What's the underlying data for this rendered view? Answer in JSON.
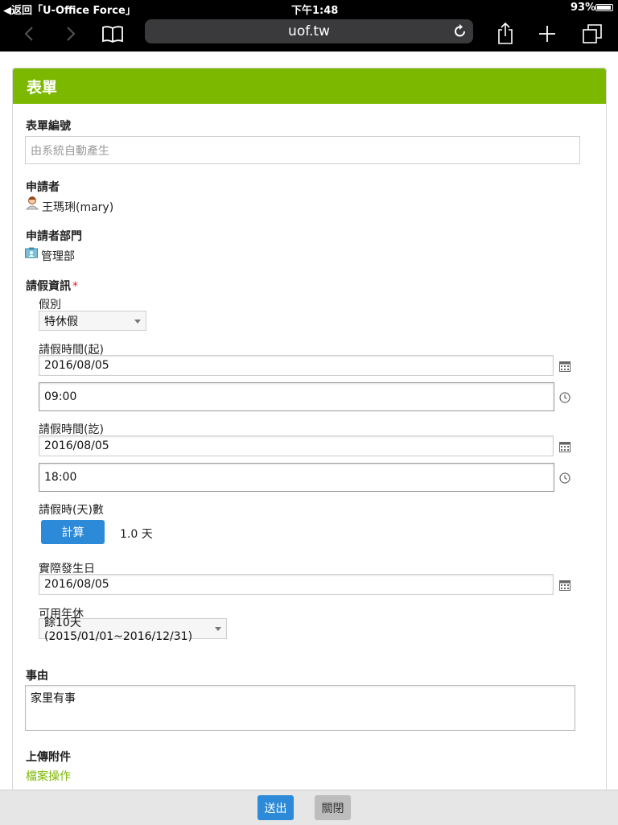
{
  "status_bar": {
    "back_app": "返回「U-Office Force」",
    "time": "下午1:48",
    "battery": "93%"
  },
  "browser": {
    "url": "uof.tw"
  },
  "form": {
    "title": "表單",
    "form_number_label": "表單編號",
    "form_number_placeholder": "由系統自動產生",
    "applicant_label": "申請者",
    "applicant_name": "王瑪琍(mary)",
    "department_label": "申請者部門",
    "department_name": "管理部",
    "leave_info_label": "請假資訊",
    "required_mark": "*",
    "leave_type_label": "假別",
    "leave_type_value": "特休假",
    "start_label": "請假時間(起)",
    "start_date": "2016/08/05",
    "start_time": "09:00",
    "end_label": "請假時間(訖)",
    "end_date": "2016/08/05",
    "end_time": "18:00",
    "duration_label": "請假時(天)數",
    "calc_button": "計算",
    "duration_value": "1.0 天",
    "occur_date_label": "實際發生日",
    "occur_date": "2016/08/05",
    "annual_leave_label": "可用年休",
    "annual_leave_value": "餘10天 (2015/01/01~2016/12/31)",
    "reason_label": "事由",
    "reason_value": "家里有事",
    "attach_label": "上傳附件",
    "attach_link": "檔案操作"
  },
  "actions": {
    "submit": "送出",
    "close": "關閉"
  },
  "colors": {
    "header_green": "#7db800",
    "button_blue": "#2d8ad8",
    "link_green": "#7db800",
    "required_red": "#e02020"
  }
}
